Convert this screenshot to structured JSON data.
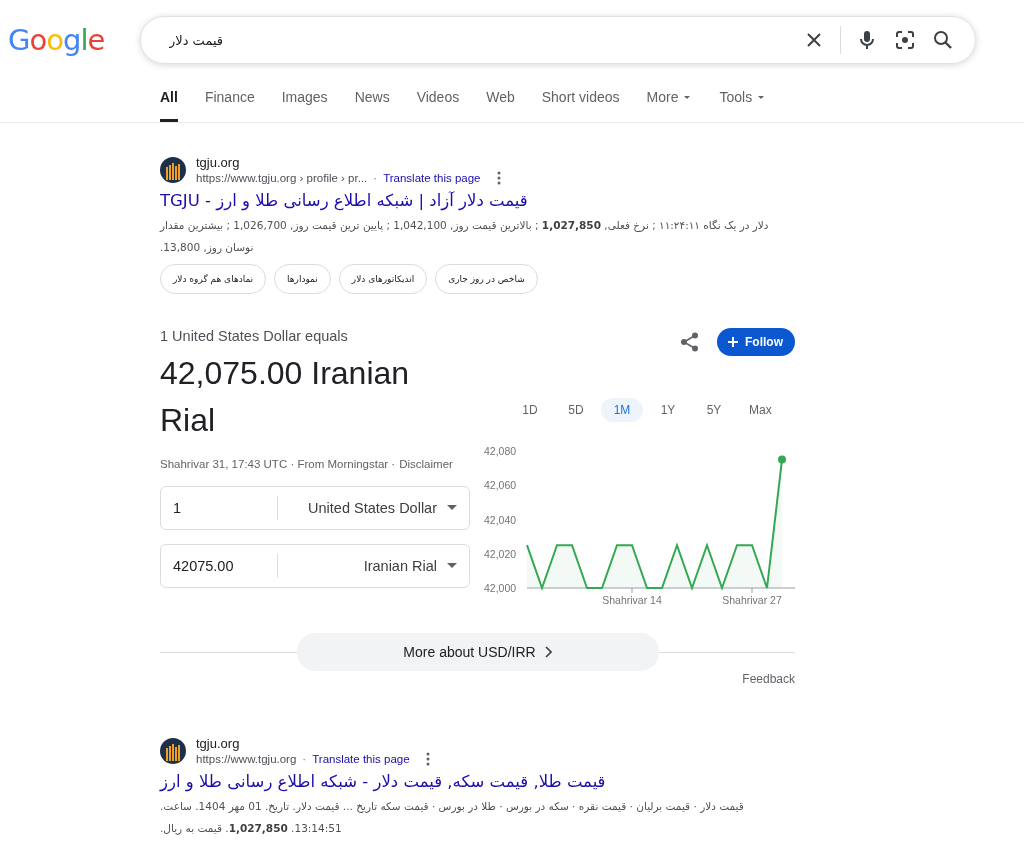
{
  "logo": "Google",
  "search": {
    "value": "قیمت دلار"
  },
  "tabs": [
    {
      "label": "All",
      "selected": true,
      "dropdown": false
    },
    {
      "label": "Finance",
      "selected": false,
      "dropdown": false
    },
    {
      "label": "Images",
      "selected": false,
      "dropdown": false
    },
    {
      "label": "News",
      "selected": false,
      "dropdown": false
    },
    {
      "label": "Videos",
      "selected": false,
      "dropdown": false
    },
    {
      "label": "Web",
      "selected": false,
      "dropdown": false
    },
    {
      "label": "Short videos",
      "selected": false,
      "dropdown": false
    },
    {
      "label": "More",
      "selected": false,
      "dropdown": true
    },
    {
      "label": "Tools",
      "selected": false,
      "dropdown": true
    }
  ],
  "first_result": {
    "site": "tgju.org",
    "url": "https://www.tgju.org › profile › pr...",
    "separator": "·",
    "translate": "Translate this page",
    "title": "قیمت دلار آزاد | شبکه اطلاع رسانی طلا و ارز - TGJU",
    "snippet": "دلار در یک نگاه ۱۱:۲۴:۱۱ ; نرخ فعلی, **1,027,850** ; بالاترین قیمت روز, 1,042,100 ; پایین ترین قیمت روز, 1,026,700 ; بیشترین مقدار نوسان روز, 13,800.",
    "chips": [
      "شاخص در روز جاری",
      "اندیکاتورهای دلار",
      "نمودارها",
      "نمادهای هم گروه دلار"
    ]
  },
  "converter": {
    "equals": "1 United States Dollar equals",
    "result": "42,075.00 Iranian Rial",
    "meta": "Shahrivar 31, 17:43 UTC · From Morningstar ·",
    "disclaimer": "Disclaimer",
    "follow": "Follow",
    "rows": [
      {
        "amount": "1",
        "currency": "United States Dollar"
      },
      {
        "amount": "42075.00",
        "currency": "Iranian Rial"
      }
    ],
    "ranges": [
      {
        "label": "1D",
        "selected": false
      },
      {
        "label": "5D",
        "selected": false
      },
      {
        "label": "1M",
        "selected": true
      },
      {
        "label": "1Y",
        "selected": false
      },
      {
        "label": "5Y",
        "selected": false
      },
      {
        "label": "Max",
        "selected": false
      }
    ],
    "chart_data": {
      "type": "line",
      "categories": [
        null,
        null,
        null,
        null,
        null,
        null,
        null,
        "Shahrivar 14",
        null,
        null,
        null,
        null,
        null,
        null,
        null,
        "Shahrivar 27",
        null,
        null
      ],
      "series": [
        {
          "color": "#34a853",
          "values": [
            42025,
            42000,
            42025,
            42025,
            42000,
            42000,
            42025,
            42025,
            42000,
            42000,
            42025,
            42000,
            42025,
            42000,
            42025,
            42025,
            42000,
            42075
          ]
        }
      ],
      "ylim": [
        42000,
        42080
      ],
      "yticks": [
        {
          "value": 42000,
          "label": "42,000"
        },
        {
          "value": 42020,
          "label": "42,020"
        },
        {
          "value": 42040,
          "label": "42,040"
        },
        {
          "value": 42060,
          "label": "42,060"
        },
        {
          "value": 42080,
          "label": "42,080"
        }
      ]
    },
    "more": "More about USD/IRR",
    "feedback": "Feedback"
  },
  "second_result": {
    "site": "tgju.org",
    "url": "https://www.tgju.org",
    "separator": "·",
    "translate": "Translate this page",
    "title": "قیمت طلا, قیمت سکه, قیمت دلار - شبکه اطلاع رسانی طلا و ارز",
    "snippet": "قیمت دلار · قیمت برلیان · قیمت نقره · سکه در بورس · طلا در بورس · قیمت سکه تاریخ ... قیمت دلار. تاریخ. 01 مهر 1404. ساعت. 13:14:51. **1,027,850**. قیمت به ریال."
  }
}
